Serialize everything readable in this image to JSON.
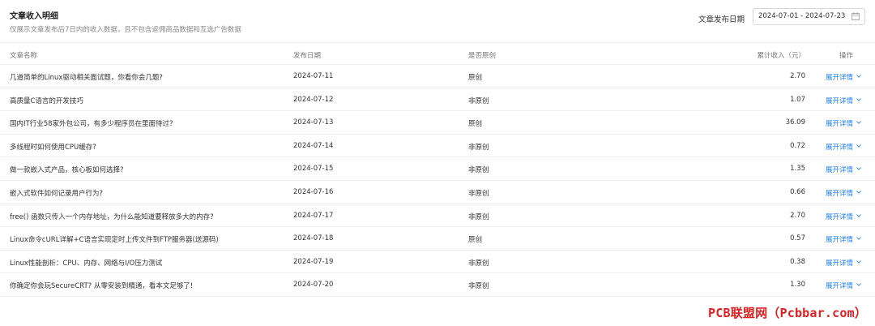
{
  "header": {
    "title": "文章收入明细",
    "subtitle": "仅展示文章发布后7日内的收入数据，且不包含返佣商品数据和互选广告数据",
    "filter_label": "文章发布日期",
    "date_range": "2024-07-01 - 2024-07-23",
    "calendar_icon": "calendar-icon"
  },
  "table": {
    "columns": {
      "name": "文章名称",
      "date": "发布日期",
      "original": "是否原创",
      "income": "累计收入（元）",
      "op": "操作"
    },
    "rows": [
      {
        "name": "几道简单的Linux驱动相关面试题，你看你会几题?",
        "date": "2024-07-11",
        "original": "原创",
        "income": "2.70",
        "action": "展开详情"
      },
      {
        "name": "高质量C语言的开发技巧",
        "date": "2024-07-12",
        "original": "非原创",
        "income": "1.07",
        "action": "展开详情"
      },
      {
        "name": "国内IT行业58家外包公司，有多少程序员在里面待过?",
        "date": "2024-07-13",
        "original": "原创",
        "income": "36.09",
        "action": "展开详情"
      },
      {
        "name": "多线程时如何使用CPU缓存?",
        "date": "2024-07-14",
        "original": "非原创",
        "income": "0.72",
        "action": "展开详情"
      },
      {
        "name": "做一款嵌入式产品，核心板如何选择?",
        "date": "2024-07-15",
        "original": "非原创",
        "income": "1.35",
        "action": "展开详情"
      },
      {
        "name": "嵌入式软件如何记录用户行为?",
        "date": "2024-07-16",
        "original": "非原创",
        "income": "0.66",
        "action": "展开详情"
      },
      {
        "name": "free() 函数只传入一个内存地址，为什么能知道要释放多大的内存?",
        "date": "2024-07-17",
        "original": "非原创",
        "income": "2.70",
        "action": "展开详情"
      },
      {
        "name": "Linux命令cURL详解+C语言实现定时上传文件到FTP服务器(送源码)",
        "date": "2024-07-18",
        "original": "原创",
        "income": "0.57",
        "action": "展开详情"
      },
      {
        "name": "Linux性能剖析：CPU、内存、网络与I/O压力测试",
        "date": "2024-07-19",
        "original": "非原创",
        "income": "0.38",
        "action": "展开详情"
      },
      {
        "name": "你确定你会玩SecureCRT? 从零安装到精通，看本文足够了!",
        "date": "2024-07-20",
        "original": "非原创",
        "income": "1.30",
        "action": "展开详情"
      }
    ]
  },
  "watermark": "PCB联盟网（Pcbbar.com）",
  "colors": {
    "accent": "#1e80ff",
    "watermark": "#e02020"
  }
}
